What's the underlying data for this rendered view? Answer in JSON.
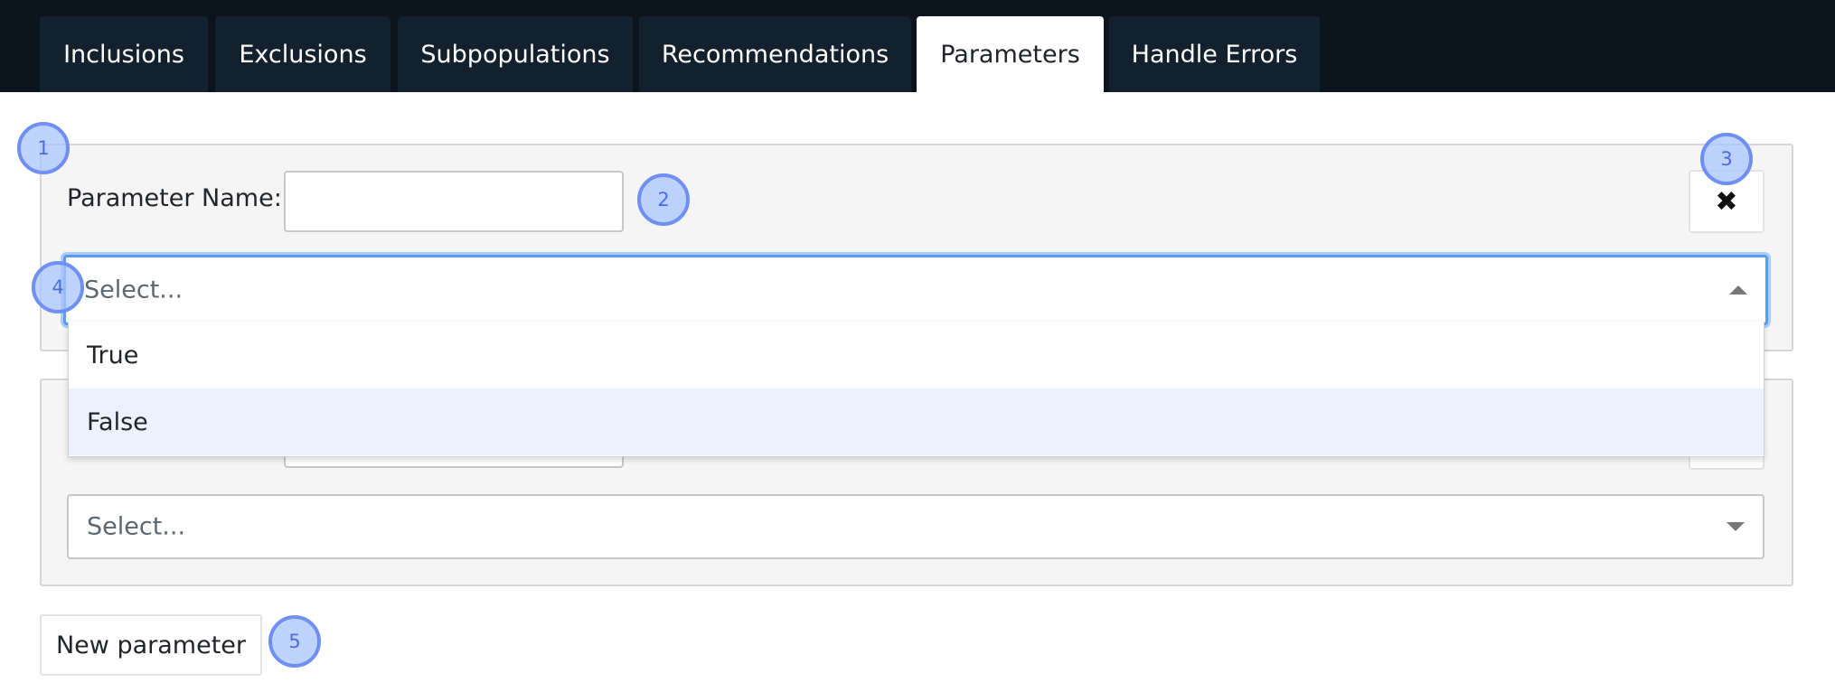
{
  "tabs": [
    {
      "label": "Inclusions",
      "active": false
    },
    {
      "label": "Exclusions",
      "active": false
    },
    {
      "label": "Subpopulations",
      "active": false
    },
    {
      "label": "Recommendations",
      "active": false
    },
    {
      "label": "Parameters",
      "active": true
    },
    {
      "label": "Handle Errors",
      "active": false
    }
  ],
  "parameters": [
    {
      "name_label": "Parameter Name:",
      "name_value": "",
      "remove_icon": "✖",
      "select_placeholder": "Select...",
      "select_open": true
    },
    {
      "select_placeholder": "Select...",
      "select_open": false
    }
  ],
  "dropdown": {
    "options": [
      "True",
      "False"
    ],
    "highlighted": "False"
  },
  "new_parameter_label": "New parameter",
  "markers": [
    "1",
    "2",
    "3",
    "4",
    "5"
  ],
  "colors": {
    "topbar": "#0b141d",
    "tab": "#13212f",
    "focus": "#5b9bf0",
    "option_hover": "#ebf2fd",
    "marker": "#6f8ff2"
  }
}
